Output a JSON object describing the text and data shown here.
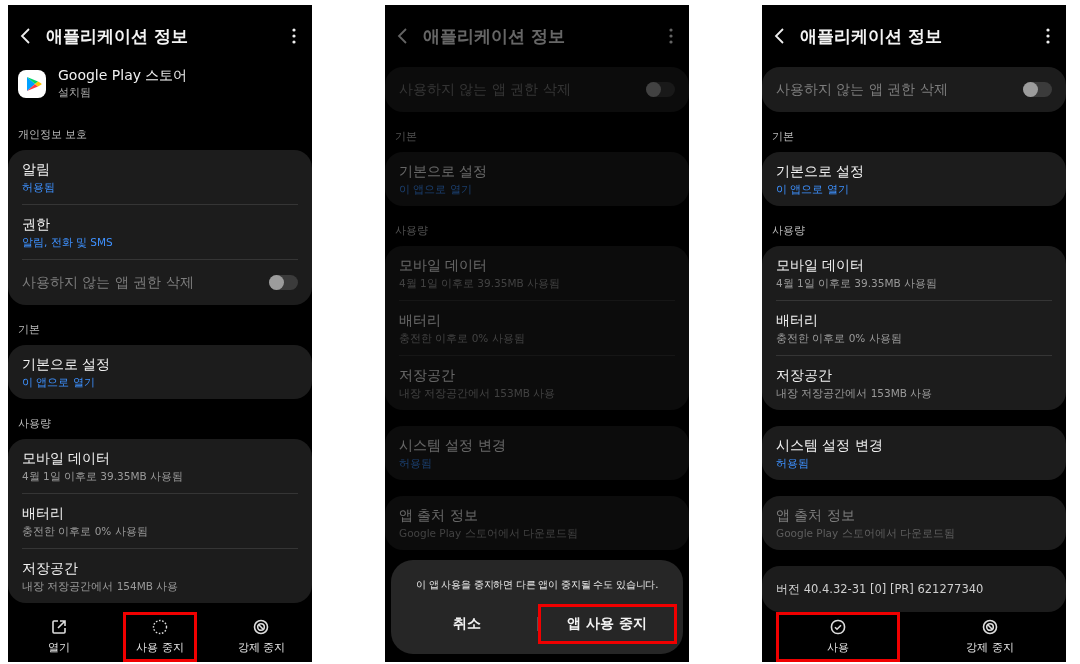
{
  "screens": [
    {
      "dimmed": false,
      "title": "애플리케이션 정보",
      "blocks": [
        {
          "kind": "app",
          "name": "Google Play 스토어",
          "status": "설치됨"
        },
        {
          "kind": "label",
          "text": "개인정보 보호"
        },
        {
          "kind": "card",
          "rows": [
            {
              "kind": "item",
              "title": "알림",
              "subtitle": "허용됨",
              "link": true,
              "disabled": false
            },
            {
              "kind": "item",
              "title": "권한",
              "subtitle": "알림, 전화 및 SMS",
              "link": true,
              "disabled": false
            },
            {
              "kind": "toggle",
              "title": "사용하지 않는 앱 권한 삭제",
              "on": false,
              "disabled": true
            }
          ]
        },
        {
          "kind": "label",
          "text": "기본"
        },
        {
          "kind": "card",
          "rows": [
            {
              "kind": "item",
              "title": "기본으로 설정",
              "subtitle": "이 앱으로 열기",
              "link": true,
              "disabled": false
            }
          ]
        },
        {
          "kind": "label",
          "text": "사용량"
        },
        {
          "kind": "card",
          "rows": [
            {
              "kind": "item",
              "title": "모바일 데이터",
              "subtitle": "4월 1일 이후로 39.35MB 사용됨",
              "link": false,
              "disabled": false
            },
            {
              "kind": "item",
              "title": "배터리",
              "subtitle": "충전한 이후로 0% 사용됨",
              "link": false,
              "disabled": false
            },
            {
              "kind": "item",
              "title": "저장공간",
              "subtitle": "내장 저장공간에서 154MB 사용",
              "link": false,
              "disabled": false
            }
          ]
        }
      ],
      "bottom_bar": [
        {
          "kind": "open",
          "label": "열기",
          "highlighted": false
        },
        {
          "kind": "disable",
          "label": "사용 중지",
          "highlighted": true
        },
        {
          "kind": "force_stop",
          "label": "강제 중지",
          "highlighted": false
        }
      ]
    },
    {
      "dimmed": true,
      "title": "애플리케이션 정보",
      "blocks": [
        {
          "kind": "card",
          "rows": [
            {
              "kind": "toggle",
              "title": "사용하지 않는 앱 권한 삭제",
              "on": false,
              "disabled": true
            }
          ]
        },
        {
          "kind": "label",
          "text": "기본"
        },
        {
          "kind": "card",
          "rows": [
            {
              "kind": "item",
              "title": "기본으로 설정",
              "subtitle": "이 앱으로 열기",
              "link": true,
              "disabled": false
            }
          ]
        },
        {
          "kind": "label",
          "text": "사용량"
        },
        {
          "kind": "card",
          "rows": [
            {
              "kind": "item",
              "title": "모바일 데이터",
              "subtitle": "4월 1일 이후로 39.35MB 사용됨",
              "link": false,
              "disabled": false
            },
            {
              "kind": "item",
              "title": "배터리",
              "subtitle": "충전한 이후로 0% 사용됨",
              "link": false,
              "disabled": false
            },
            {
              "kind": "item",
              "title": "저장공간",
              "subtitle": "내장 저장공간에서 153MB 사용",
              "link": false,
              "disabled": false
            }
          ]
        },
        {
          "kind": "card",
          "rows": [
            {
              "kind": "item",
              "title": "시스템 설정 변경",
              "subtitle": "허용됨",
              "link": true,
              "disabled": false
            }
          ]
        },
        {
          "kind": "card",
          "rows": [
            {
              "kind": "item",
              "title": "앱 출처 정보",
              "subtitle": "Google Play 스토어에서 다운로드됨",
              "link": false,
              "disabled": false
            }
          ]
        }
      ],
      "dialog": {
        "message": "이 앱 사용을 중지하면 다른 앱이 중지될 수도 있습니다.",
        "buttons": [
          {
            "label": "취소",
            "highlighted": false
          },
          {
            "label": "앱 사용 중지",
            "highlighted": true
          }
        ]
      }
    },
    {
      "dimmed": false,
      "title": "애플리케이션 정보",
      "blocks": [
        {
          "kind": "card",
          "rows": [
            {
              "kind": "toggle",
              "title": "사용하지 않는 앱 권한 삭제",
              "on": false,
              "disabled": true
            }
          ]
        },
        {
          "kind": "label",
          "text": "기본"
        },
        {
          "kind": "card",
          "rows": [
            {
              "kind": "item",
              "title": "기본으로 설정",
              "subtitle": "이 앱으로 열기",
              "link": true,
              "disabled": false
            }
          ]
        },
        {
          "kind": "label",
          "text": "사용량"
        },
        {
          "kind": "card",
          "rows": [
            {
              "kind": "item",
              "title": "모바일 데이터",
              "subtitle": "4월 1일 이후로 39.35MB 사용됨",
              "link": false,
              "disabled": false
            },
            {
              "kind": "item",
              "title": "배터리",
              "subtitle": "충전한 이후로 0% 사용됨",
              "link": false,
              "disabled": false
            },
            {
              "kind": "item",
              "title": "저장공간",
              "subtitle": "내장 저장공간에서 153MB 사용",
              "link": false,
              "disabled": false
            }
          ]
        },
        {
          "kind": "card",
          "rows": [
            {
              "kind": "item",
              "title": "시스템 설정 변경",
              "subtitle": "허용됨",
              "link": true,
              "disabled": false
            }
          ]
        },
        {
          "kind": "card",
          "rows": [
            {
              "kind": "item",
              "title": "앱 출처 정보",
              "subtitle": "Google Play 스토어에서 다운로드됨",
              "link": false,
              "disabled": true
            }
          ]
        },
        {
          "kind": "card",
          "rows": [
            {
              "kind": "text",
              "title": "버전 40.4.32-31 [0] [PR] 621277340"
            }
          ]
        }
      ],
      "bottom_bar": [
        {
          "kind": "enable",
          "label": "사용",
          "highlighted": true
        },
        {
          "kind": "force_stop",
          "label": "강제 중지",
          "highlighted": false
        }
      ]
    }
  ]
}
